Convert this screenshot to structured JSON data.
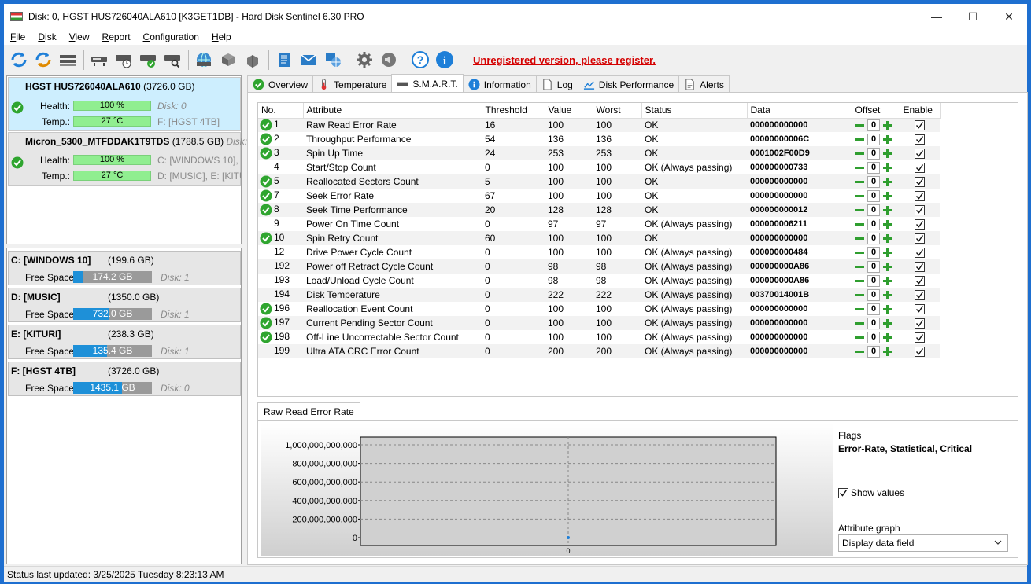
{
  "window": {
    "title": "Disk: 0, HGST HUS726040ALA610 [K3GET1DB]  -  Hard Disk Sentinel 6.30 PRO",
    "controls": [
      "minimize",
      "maximize",
      "close"
    ]
  },
  "menu": [
    {
      "pre": "",
      "key": "F",
      "post": "ile"
    },
    {
      "pre": "",
      "key": "D",
      "post": "isk"
    },
    {
      "pre": "",
      "key": "V",
      "post": "iew"
    },
    {
      "pre": "",
      "key": "R",
      "post": "eport"
    },
    {
      "pre": "",
      "key": "C",
      "post": "onfiguration"
    },
    {
      "pre": "",
      "key": "H",
      "post": "elp"
    }
  ],
  "toolbar": {
    "unregistered": "Unregistered version, please register."
  },
  "disks": [
    {
      "name": "HGST HUS726040ALA610",
      "size": "(3726.0 GB)",
      "health_label": "Health:",
      "health": "100 %",
      "health_pct": 100,
      "temp_label": "Temp.:",
      "temp": "27 °C",
      "right1": "Disk: 0",
      "right2": "F: [HGST 4TB]"
    },
    {
      "name": "Micron_5300_MTFDDAK1T9TDS",
      "size": "(1788.5 GB)",
      "extra": "Disk:",
      "health_label": "Health:",
      "health": "100 %",
      "health_pct": 100,
      "temp_label": "Temp.:",
      "temp": "27 °C",
      "right1": "C: [WINDOWS 10],",
      "right2": "D: [MUSIC], E: [KITU"
    }
  ],
  "volumes": [
    {
      "name": "C: [WINDOWS 10]",
      "size": "(199.6 GB)",
      "free_label": "Free Space",
      "free": "174.2 GB",
      "used_fraction": 0.127,
      "disk": "Disk: 1"
    },
    {
      "name": "D: [MUSIC]",
      "size": "(1350.0 GB)",
      "free_label": "Free Space",
      "free": "732.0 GB",
      "used_fraction": 0.458,
      "disk": "Disk: 1"
    },
    {
      "name": "E: [KITURI]",
      "size": "(238.3 GB)",
      "free_label": "Free Space",
      "free": "135.4 GB",
      "used_fraction": 0.432,
      "disk": "Disk: 1"
    },
    {
      "name": "F: [HGST 4TB]",
      "size": "(3726.0 GB)",
      "free_label": "Free Space",
      "free": "1435.1 GB",
      "used_fraction": 0.615,
      "disk": "Disk: 0"
    }
  ],
  "tabs": [
    "Overview",
    "Temperature",
    "S.M.A.R.T.",
    "Information",
    "Log",
    "Disk Performance",
    "Alerts"
  ],
  "smart": {
    "headers": [
      "No.",
      "Attribute",
      "Threshold",
      "Value",
      "Worst",
      "Status",
      "Data",
      "Offset",
      "Enable"
    ],
    "rows": [
      {
        "ok": true,
        "no": "1",
        "attr": "Raw Read Error Rate",
        "thr": "16",
        "val": "100",
        "worst": "100",
        "status": "OK",
        "data": "000000000000",
        "offset": "0"
      },
      {
        "ok": true,
        "no": "2",
        "attr": "Throughput Performance",
        "thr": "54",
        "val": "136",
        "worst": "136",
        "status": "OK",
        "data": "00000000006C",
        "offset": "0"
      },
      {
        "ok": true,
        "no": "3",
        "attr": "Spin Up Time",
        "thr": "24",
        "val": "253",
        "worst": "253",
        "status": "OK",
        "data": "0001002F00D9",
        "offset": "0"
      },
      {
        "ok": false,
        "no": "4",
        "attr": "Start/Stop Count",
        "thr": "0",
        "val": "100",
        "worst": "100",
        "status": "OK (Always passing)",
        "data": "000000000733",
        "offset": "0"
      },
      {
        "ok": true,
        "no": "5",
        "attr": "Reallocated Sectors Count",
        "thr": "5",
        "val": "100",
        "worst": "100",
        "status": "OK",
        "data": "000000000000",
        "offset": "0"
      },
      {
        "ok": true,
        "no": "7",
        "attr": "Seek Error Rate",
        "thr": "67",
        "val": "100",
        "worst": "100",
        "status": "OK",
        "data": "000000000000",
        "offset": "0"
      },
      {
        "ok": true,
        "no": "8",
        "attr": "Seek Time Performance",
        "thr": "20",
        "val": "128",
        "worst": "128",
        "status": "OK",
        "data": "000000000012",
        "offset": "0"
      },
      {
        "ok": false,
        "no": "9",
        "attr": "Power On Time Count",
        "thr": "0",
        "val": "97",
        "worst": "97",
        "status": "OK (Always passing)",
        "data": "000000006211",
        "offset": "0"
      },
      {
        "ok": true,
        "no": "10",
        "attr": "Spin Retry Count",
        "thr": "60",
        "val": "100",
        "worst": "100",
        "status": "OK",
        "data": "000000000000",
        "offset": "0"
      },
      {
        "ok": false,
        "no": "12",
        "attr": "Drive Power Cycle Count",
        "thr": "0",
        "val": "100",
        "worst": "100",
        "status": "OK (Always passing)",
        "data": "000000000484",
        "offset": "0"
      },
      {
        "ok": false,
        "no": "192",
        "attr": "Power off Retract Cycle Count",
        "thr": "0",
        "val": "98",
        "worst": "98",
        "status": "OK (Always passing)",
        "data": "000000000A86",
        "offset": "0"
      },
      {
        "ok": false,
        "no": "193",
        "attr": "Load/Unload Cycle Count",
        "thr": "0",
        "val": "98",
        "worst": "98",
        "status": "OK (Always passing)",
        "data": "000000000A86",
        "offset": "0"
      },
      {
        "ok": false,
        "no": "194",
        "attr": "Disk Temperature",
        "thr": "0",
        "val": "222",
        "worst": "222",
        "status": "OK (Always passing)",
        "data": "00370014001B",
        "offset": "0"
      },
      {
        "ok": true,
        "no": "196",
        "attr": "Reallocation Event Count",
        "thr": "0",
        "val": "100",
        "worst": "100",
        "status": "OK (Always passing)",
        "data": "000000000000",
        "offset": "0"
      },
      {
        "ok": true,
        "no": "197",
        "attr": "Current Pending Sector Count",
        "thr": "0",
        "val": "100",
        "worst": "100",
        "status": "OK (Always passing)",
        "data": "000000000000",
        "offset": "0"
      },
      {
        "ok": true,
        "no": "198",
        "attr": "Off-Line Uncorrectable Sector Count",
        "thr": "0",
        "val": "100",
        "worst": "100",
        "status": "OK (Always passing)",
        "data": "000000000000",
        "offset": "0"
      },
      {
        "ok": false,
        "no": "199",
        "attr": "Ultra ATA CRC Error Count",
        "thr": "0",
        "val": "200",
        "worst": "200",
        "status": "OK (Always passing)",
        "data": "000000000000",
        "offset": "0"
      }
    ]
  },
  "graph": {
    "tab": "Raw Read Error Rate",
    "flags_label": "Flags",
    "flags_value": "Error-Rate, Statistical, Critical",
    "show_values": "Show values",
    "attr_graph_label": "Attribute graph",
    "attr_graph_value": "Display data field"
  },
  "chart_data": {
    "type": "line",
    "title": "",
    "yticks": [
      "1,000,000,000,000",
      "800,000,000,000",
      "600,000,000,000",
      "400,000,000,000",
      "200,000,000,000",
      "0"
    ],
    "ylim": [
      0,
      1000000000000
    ],
    "point_label": "0",
    "series": [
      {
        "values": [
          0
        ]
      }
    ]
  },
  "status": "Status last updated: 3/25/2025 Tuesday 8:23:13 AM",
  "colors": {
    "accent": "#1e90d8",
    "ok": "#2fa52f",
    "warn_link": "#d40000",
    "health_bar": "#90ee90"
  }
}
